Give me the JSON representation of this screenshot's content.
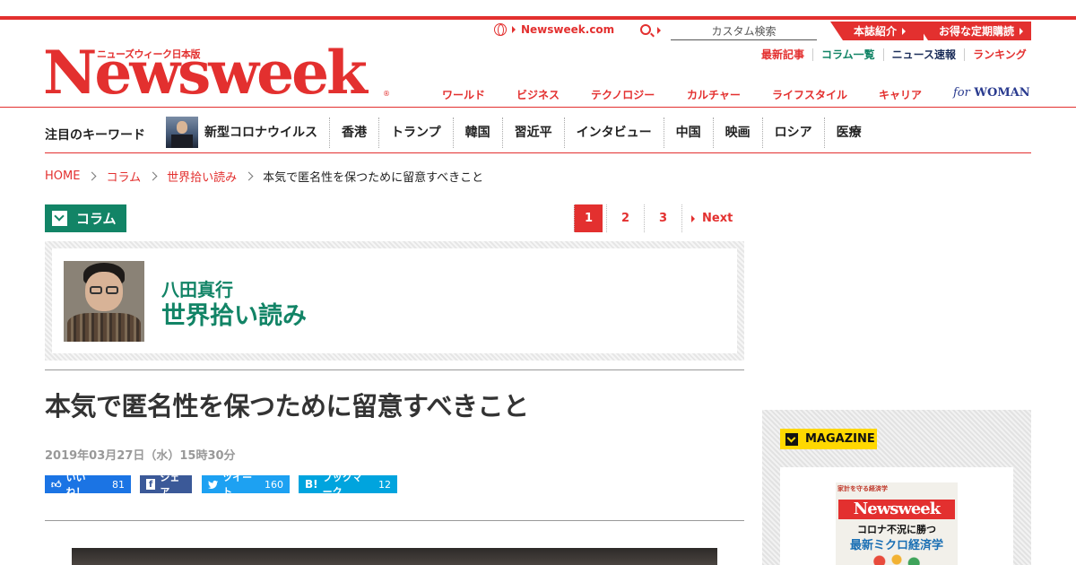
{
  "header": {
    "logo_sub": "ニューズウィーク日本版",
    "logo": "Newsweek",
    "logo_reg": "®",
    "site_link": "Newsweek.com",
    "search_placeholder": "カスタム検索",
    "red_tabs": [
      "本誌紹介",
      "お得な定期購読"
    ],
    "sub_nav": [
      {
        "label": "最新記事",
        "color": "#e3302f"
      },
      {
        "label": "コラム一覧",
        "color": "#128466"
      },
      {
        "label": "ニュース速報",
        "color": "#1c2e5a"
      },
      {
        "label": "ランキング",
        "color": "#e3302f"
      }
    ],
    "main_nav": [
      "ワールド",
      "ビジネス",
      "テクノロジー",
      "カルチャー",
      "ライフスタイル",
      "キャリア"
    ],
    "for_woman": {
      "for": "for",
      "woman": "WOMAN"
    }
  },
  "keywords": {
    "title": "注目のキーワード",
    "items": [
      "新型コロナウイルス",
      "香港",
      "トランプ",
      "韓国",
      "習近平",
      "インタビュー",
      "中国",
      "映画",
      "ロシア",
      "医療"
    ]
  },
  "breadcrumb": [
    "HOME",
    "コラム",
    "世界拾い読み",
    "本気で匿名性を保つために留意すべきこと"
  ],
  "column_tag": "コラム",
  "pagination": {
    "pages": [
      "1",
      "2",
      "3"
    ],
    "current": "1",
    "next": "Next"
  },
  "author": {
    "name": "八田真行",
    "column": "世界拾い読み"
  },
  "article": {
    "title": "本気で匿名性を保つために留意すべきこと",
    "date": "2019年03月27日（水）15時30分"
  },
  "social": {
    "like": {
      "label": "いいね！",
      "count": "81"
    },
    "share": {
      "label": "シェア"
    },
    "tweet": {
      "label": "ツイート",
      "count": "160"
    },
    "bookmark": {
      "label": "ブックマーク",
      "count": "12"
    }
  },
  "sidebar": {
    "magazine_label": "MAGAZINE",
    "cover": {
      "top": "家計を守る経済学",
      "logo": "Newsweek",
      "headline1": "コロナ不況に勝つ",
      "headline2": "最新ミクロ経済学"
    }
  },
  "colors": {
    "brand_red": "#e3302f",
    "column_green": "#128466",
    "magazine_yellow": "#ffd800"
  }
}
